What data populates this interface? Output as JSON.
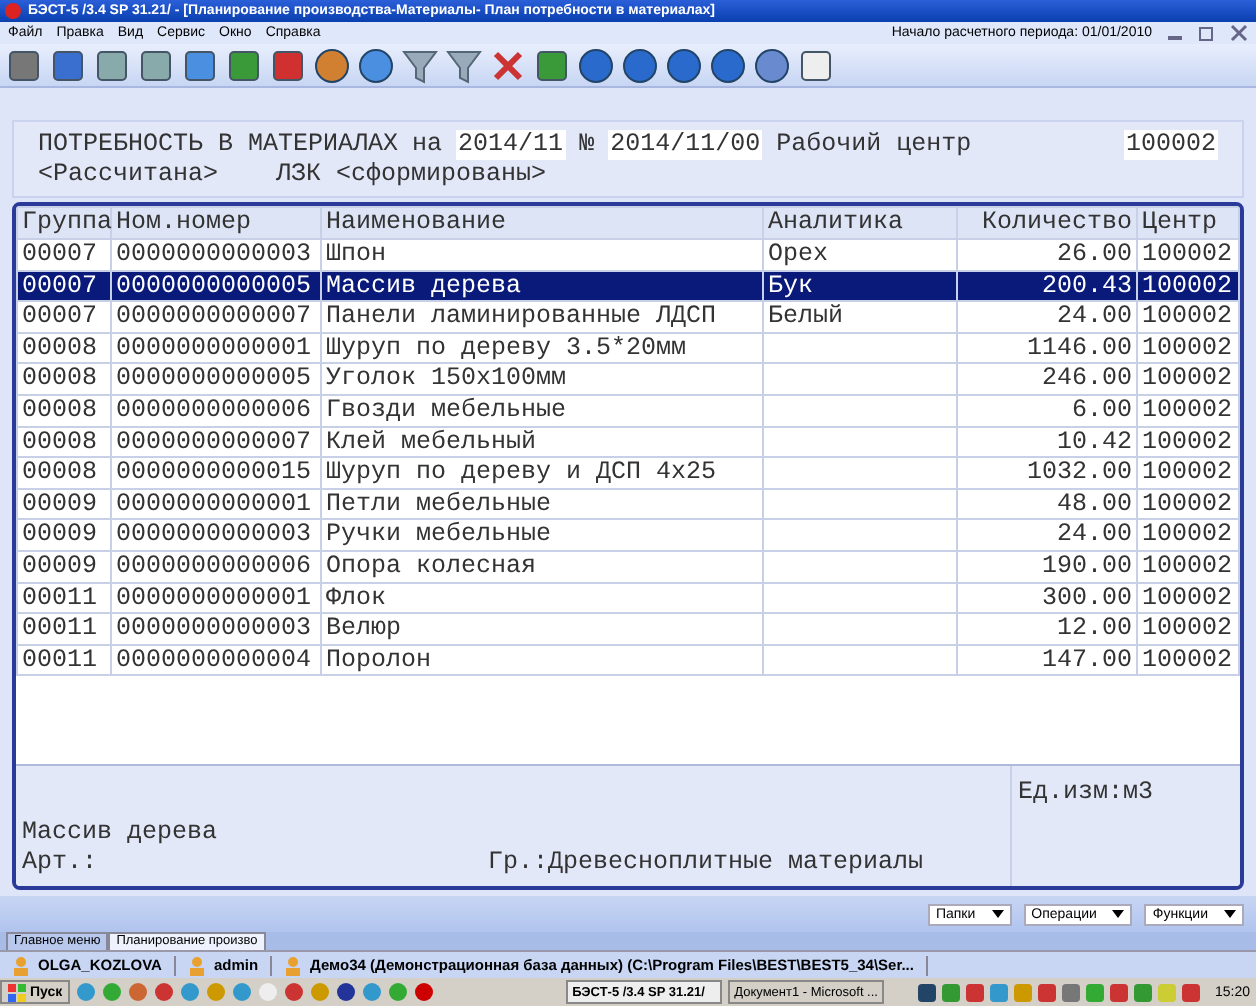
{
  "window": {
    "title": "БЭСТ-5 /3.4 SP 31.21/ - [Планирование производства-Материалы- План потребности в материалах]"
  },
  "menu": [
    "Файл",
    "Правка",
    "Вид",
    "Сервис",
    "Окно",
    "Справка"
  ],
  "period_label": "Начало расчетного периода: 01/01/2010",
  "header": {
    "title": "ПОТРЕБНОСТЬ В МАТЕРИАЛАХ",
    "on_label": "на",
    "period": "2014/11",
    "number_label": "№",
    "number": "2014/11/00",
    "center_label": "Рабочий центр",
    "center": "100002",
    "status": "<Рассчитана>",
    "lzk": "ЛЗК <сформированы>"
  },
  "table": {
    "columns": [
      "Группа",
      "Ном.номер",
      "Наименование",
      "Аналитика",
      "Количество",
      "Центр"
    ],
    "rows": [
      {
        "cells": [
          "00007",
          "0000000000003",
          "Шпон",
          "Орех",
          "26.00",
          "100002"
        ],
        "selected": false
      },
      {
        "cells": [
          "00007",
          "0000000000005",
          "Массив дерева",
          "Бук",
          "200.43",
          "100002"
        ],
        "selected": true
      },
      {
        "cells": [
          "00007",
          "0000000000007",
          "Панели ламинированные ЛДСП",
          "Белый",
          "24.00",
          "100002"
        ],
        "selected": false
      },
      {
        "cells": [
          "00008",
          "0000000000001",
          "Шуруп по дереву 3.5*20мм",
          "",
          "1146.00",
          "100002"
        ],
        "selected": false
      },
      {
        "cells": [
          "00008",
          "0000000000005",
          "Уголок 150х100мм",
          "",
          "246.00",
          "100002"
        ],
        "selected": false
      },
      {
        "cells": [
          "00008",
          "0000000000006",
          "Гвозди мебельные",
          "",
          "6.00",
          "100002"
        ],
        "selected": false
      },
      {
        "cells": [
          "00008",
          "0000000000007",
          "Клей мебельный",
          "",
          "10.42",
          "100002"
        ],
        "selected": false
      },
      {
        "cells": [
          "00008",
          "0000000000015",
          "Шуруп по дереву и ДСП 4х25",
          "",
          "1032.00",
          "100002"
        ],
        "selected": false
      },
      {
        "cells": [
          "00009",
          "0000000000001",
          "Петли мебельные",
          "",
          "48.00",
          "100002"
        ],
        "selected": false
      },
      {
        "cells": [
          "00009",
          "0000000000003",
          "Ручки мебельные",
          "",
          "24.00",
          "100002"
        ],
        "selected": false
      },
      {
        "cells": [
          "00009",
          "0000000000006",
          "Опора колесная",
          "",
          "190.00",
          "100002"
        ],
        "selected": false
      },
      {
        "cells": [
          "00011",
          "0000000000001",
          "Флок",
          "",
          "300.00",
          "100002"
        ],
        "selected": false
      },
      {
        "cells": [
          "00011",
          "0000000000003",
          "Велюр",
          "",
          "12.00",
          "100002"
        ],
        "selected": false
      },
      {
        "cells": [
          "00011",
          "0000000000004",
          "Поролон",
          "",
          "147.00",
          "100002"
        ],
        "selected": false
      }
    ]
  },
  "details": {
    "name": "Массив дерева",
    "article": "Арт.:",
    "group": "Гр.:Древесноплитные материалы",
    "unit": "Ед.изм:м3"
  },
  "panel_buttons": [
    "Папки",
    "Операции",
    "Функции"
  ],
  "tabs": [
    {
      "label": "Главное меню",
      "selected": false
    },
    {
      "label": "Планирование произво",
      "selected": true
    }
  ],
  "status_bar": [
    "OLGA_KOZLOVA",
    "admin",
    "Демо34 (Демонстрационная база данных) (C:\\Program Files\\BEST\\BEST5_34\\Ser..."
  ],
  "taskbar": {
    "start": "Пуск",
    "tasks": [
      {
        "label": "БЭСТ-5 /3.4 SP 31.21/",
        "selected": true
      },
      {
        "label": "Документ1 - Microsoft ...",
        "selected": false
      }
    ],
    "clock": "15:20"
  }
}
